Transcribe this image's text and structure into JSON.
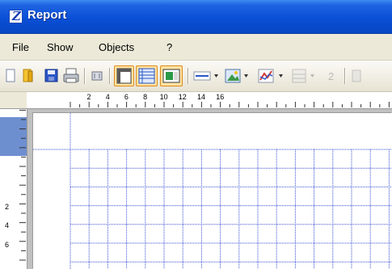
{
  "window": {
    "title": "Report",
    "app_icon_glyph": "Z"
  },
  "menu": {
    "items": [
      "File",
      "Show",
      "Objects",
      "?"
    ]
  },
  "toolbar": {
    "buttons": [
      {
        "icon": "new-page-icon"
      },
      {
        "icon": "open-folder-icon"
      },
      {
        "icon": "save-disk-icon"
      },
      {
        "icon": "print-icon"
      },
      {
        "icon": "page-setup-icon"
      },
      {
        "icon": "rulers-icon",
        "active": true
      },
      {
        "icon": "grid-icon",
        "active": true
      },
      {
        "icon": "toggle-area-icon",
        "active": true
      },
      {
        "icon": "line-style-icon"
      },
      {
        "icon": "insert-image-icon"
      },
      {
        "icon": "insert-chart-icon"
      },
      {
        "icon": "table-icon"
      },
      {
        "icon": "page-number-icon"
      }
    ]
  },
  "ruler": {
    "h_labels": [
      "2",
      "4",
      "6",
      "8",
      "10",
      "12",
      "14",
      "16"
    ],
    "v_labels": [
      "2",
      "4",
      "6"
    ]
  },
  "colors": {
    "titlebar": "#0a4fd6",
    "grid_line": "#3a4fd0",
    "ruler_band": "#6e8fcf",
    "active_button": "#ffe3a3"
  }
}
